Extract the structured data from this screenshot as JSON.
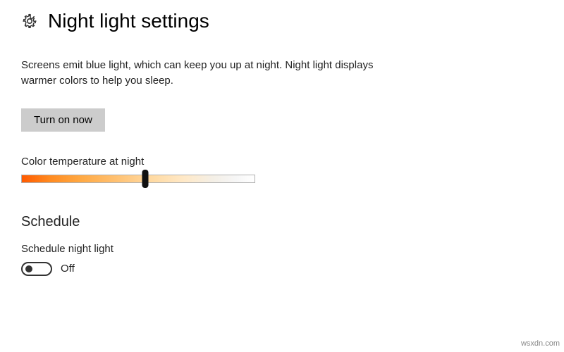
{
  "header": {
    "title": "Night light settings",
    "icon": "gear-icon"
  },
  "description": "Screens emit blue light, which can keep you up at night. Night light displays warmer colors to help you sleep.",
  "turn_on_button": "Turn on now",
  "color_temperature": {
    "label": "Color temperature at night",
    "value_percent": 53,
    "gradient": [
      "#ff5a00",
      "#ff8a20",
      "#ffa842",
      "#ffc070",
      "#ffd9a0",
      "#ffe9c8",
      "#f4efe6",
      "#f6f6f6",
      "#ffffff"
    ]
  },
  "schedule": {
    "heading": "Schedule",
    "label": "Schedule night light",
    "toggle_on": false,
    "toggle_state_text": "Off"
  },
  "watermark": "wsxdn.com"
}
